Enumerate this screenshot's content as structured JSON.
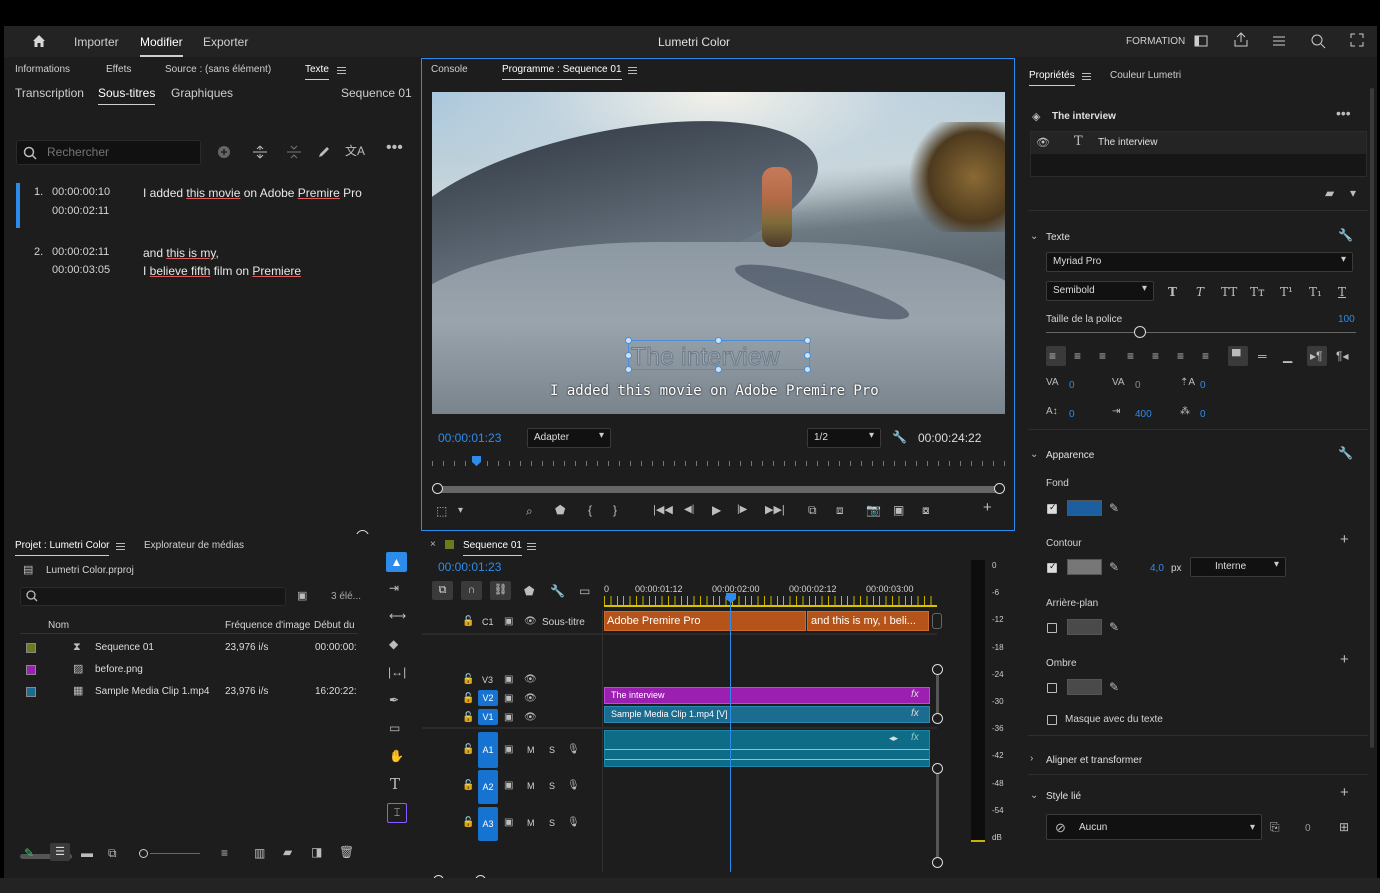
{
  "header": {
    "home_icon": "home-icon",
    "nav": [
      "Importer",
      "Modifier",
      "Exporter"
    ],
    "title": "Lumetri Color",
    "workspace": "FORMATION"
  },
  "text_panel": {
    "tabs_top": [
      "Informations",
      "Effets",
      "Source : (sans élément)",
      "Texte"
    ],
    "tabs_sub": [
      "Transcription",
      "Sous-titres",
      "Graphiques"
    ],
    "sequence": "Sequence 01",
    "search_placeholder": "Rechercher",
    "captions": [
      {
        "num": "1.",
        "in": "00:00:00:10",
        "out": "00:00:02:11",
        "line1": "I added this movie on Adobe Premire Pro",
        "line2": ""
      },
      {
        "num": "2.",
        "in": "00:00:02:11",
        "out": "00:00:03:05",
        "line1": "and this is my,",
        "line2": "I believe fifth film on Premiere"
      }
    ]
  },
  "program": {
    "tabs": [
      "Console",
      "Programme : Sequence 01"
    ],
    "title_overlay": "The interview",
    "subtitle_overlay": "I added this movie on Adobe Premire Pro",
    "timecode": "00:00:01:23",
    "fit": "Adapter",
    "quality": "1/2",
    "duration": "00:00:24:22"
  },
  "project": {
    "tabs": [
      "Projet : Lumetri Color",
      "Explorateur de médias"
    ],
    "file": "Lumetri Color.prproj",
    "count": "3 élé...",
    "columns": [
      "Nom",
      "Fréquence d'image",
      "Début du"
    ],
    "items": [
      {
        "color": "#6b7a1e",
        "name": "Sequence 01",
        "fps": "23,976 i/s",
        "start": "00:00:00:"
      },
      {
        "color": "#9b1fb0",
        "name": "before.png",
        "fps": "",
        "start": ""
      },
      {
        "color": "#1b6c8f",
        "name": "Sample Media Clip 1.mp4",
        "fps": "23,976 i/s",
        "start": "16:20:22:"
      }
    ]
  },
  "timeline": {
    "tab": "Sequence 01",
    "timecode": "00:00:01:23",
    "ruler": [
      "0",
      "00:00:01:12",
      "00:00:02:00",
      "00:00:02:12",
      "00:00:03:00"
    ],
    "subtitle_track": "Sous-titre",
    "c1": "C1",
    "clip_c1a": "Adobe Premire Pro",
    "clip_c1b": "and this is my, I beli...",
    "video_tracks": [
      "V3",
      "V2",
      "V1"
    ],
    "clip_v2": "The interview",
    "clip_v1": "Sample Media Clip 1.mp4 [V]",
    "audio_tracks": [
      "A1",
      "A2",
      "A3"
    ],
    "fx": "fx",
    "m": "M",
    "s": "S",
    "meter_labels": [
      "0",
      "-6",
      "-12",
      "-18",
      "-24",
      "-30",
      "-36",
      "-42",
      "-48",
      "-54",
      "dB"
    ]
  },
  "properties": {
    "tabs": [
      "Propriétés",
      "Couleur Lumetri"
    ],
    "layer_group": "The interview",
    "layer_item": "The interview",
    "texte_label": "Texte",
    "font": "Myriad Pro",
    "style": "Semibold",
    "size_label": "Taille de la police",
    "size_value": "100",
    "size_fraction": 0.4,
    "tracking": [
      "0",
      "0",
      "0"
    ],
    "leading": [
      "0",
      "400",
      "0"
    ],
    "appearance_label": "Apparence",
    "fond": "Fond",
    "fond_color": "#1b5f9e",
    "contour": "Contour",
    "contour_color": "#777777",
    "contour_width": "4,0",
    "px": "px",
    "contour_type": "Interne",
    "arriere": "Arrière-plan",
    "ombre": "Ombre",
    "masque": "Masque avec du texte",
    "align": "Aligner et transformer",
    "style_lie": "Style lié",
    "style_value": "Aucun",
    "style_count": "0"
  }
}
